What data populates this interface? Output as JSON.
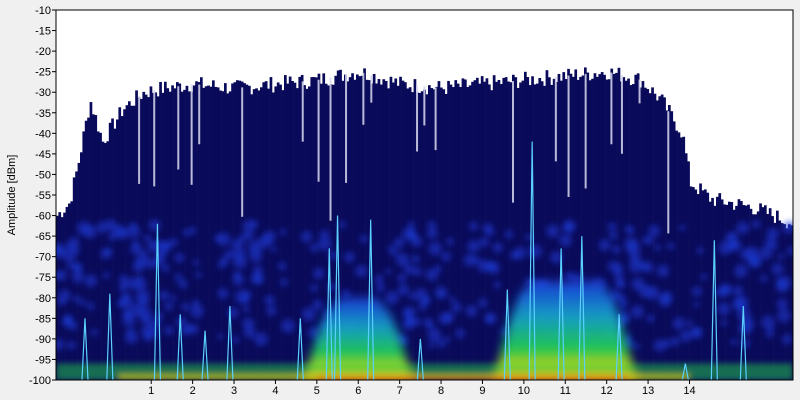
{
  "chart_data": {
    "type": "heatmap",
    "subtype": "wifi-spectrum-density",
    "ylabel": "Amplitude [dBm]",
    "ylim": [
      -100,
      -10
    ],
    "y_ticks": [
      -10,
      -15,
      -20,
      -25,
      -30,
      -35,
      -40,
      -45,
      -50,
      -55,
      -60,
      -65,
      -70,
      -75,
      -80,
      -85,
      -90,
      -95,
      -100
    ],
    "x_ticks": [
      {
        "channel": 1,
        "label": "1"
      },
      {
        "channel": 2,
        "label": "2"
      },
      {
        "channel": 3,
        "label": "3"
      },
      {
        "channel": 4,
        "label": "4"
      },
      {
        "channel": 5,
        "label": "5"
      },
      {
        "channel": 6,
        "label": "6"
      },
      {
        "channel": 7,
        "label": "7"
      },
      {
        "channel": 8,
        "label": "8"
      },
      {
        "channel": 9,
        "label": "9"
      },
      {
        "channel": 10,
        "label": "10"
      },
      {
        "channel": 11,
        "label": "11"
      },
      {
        "channel": 12,
        "label": "12"
      },
      {
        "channel": 13,
        "label": "13"
      },
      {
        "channel": 14,
        "label": "14"
      }
    ],
    "xlim": [
      -1.3,
      16.5
    ],
    "grid": true,
    "colors": {
      "background": "#0a0a5a",
      "peak_hold": "#0d1a7a",
      "density_low": "#1c3dd8",
      "density_mid": "#22d04a",
      "density_high": "#ffe000",
      "density_max": "#ff2000",
      "trace": "#5ad0ff"
    },
    "peak_hold": [
      {
        "x": -1.3,
        "y": -60
      },
      {
        "x": -1.0,
        "y": -57
      },
      {
        "x": -0.8,
        "y": -48
      },
      {
        "x": -0.5,
        "y": -32
      },
      {
        "x": -0.2,
        "y": -42
      },
      {
        "x": 0.3,
        "y": -34
      },
      {
        "x": 0.8,
        "y": -30
      },
      {
        "x": 1.3,
        "y": -29
      },
      {
        "x": 2.0,
        "y": -28
      },
      {
        "x": 3.0,
        "y": -29
      },
      {
        "x": 4.0,
        "y": -28
      },
      {
        "x": 5.0,
        "y": -27
      },
      {
        "x": 6.0,
        "y": -25
      },
      {
        "x": 7.0,
        "y": -28
      },
      {
        "x": 8.0,
        "y": -29
      },
      {
        "x": 9.0,
        "y": -28
      },
      {
        "x": 10.0,
        "y": -27
      },
      {
        "x": 11.0,
        "y": -26
      },
      {
        "x": 12.0,
        "y": -25
      },
      {
        "x": 12.8,
        "y": -27
      },
      {
        "x": 13.3,
        "y": -32
      },
      {
        "x": 13.8,
        "y": -40
      },
      {
        "x": 14.0,
        "y": -52
      },
      {
        "x": 14.5,
        "y": -56
      },
      {
        "x": 15.0,
        "y": -57
      },
      {
        "x": 15.5,
        "y": -58
      },
      {
        "x": 16.0,
        "y": -60
      },
      {
        "x": 16.5,
        "y": -62
      }
    ],
    "density_regions": [
      {
        "center": 6.0,
        "width": 2.2,
        "level": -80
      },
      {
        "center": 11.0,
        "width": 3.0,
        "level": -76
      }
    ],
    "spikes": [
      {
        "x": -0.6,
        "y": -85
      },
      {
        "x": 0.0,
        "y": -79
      },
      {
        "x": 1.15,
        "y": -62
      },
      {
        "x": 1.7,
        "y": -84
      },
      {
        "x": 2.3,
        "y": -88
      },
      {
        "x": 2.9,
        "y": -82
      },
      {
        "x": 4.6,
        "y": -85
      },
      {
        "x": 5.3,
        "y": -68
      },
      {
        "x": 5.5,
        "y": -60
      },
      {
        "x": 6.3,
        "y": -61
      },
      {
        "x": 7.5,
        "y": -90
      },
      {
        "x": 9.6,
        "y": -78
      },
      {
        "x": 10.2,
        "y": -42
      },
      {
        "x": 10.9,
        "y": -68
      },
      {
        "x": 11.4,
        "y": -65
      },
      {
        "x": 12.3,
        "y": -84
      },
      {
        "x": 13.9,
        "y": -96
      },
      {
        "x": 14.6,
        "y": -66
      },
      {
        "x": 15.3,
        "y": -82
      }
    ]
  }
}
